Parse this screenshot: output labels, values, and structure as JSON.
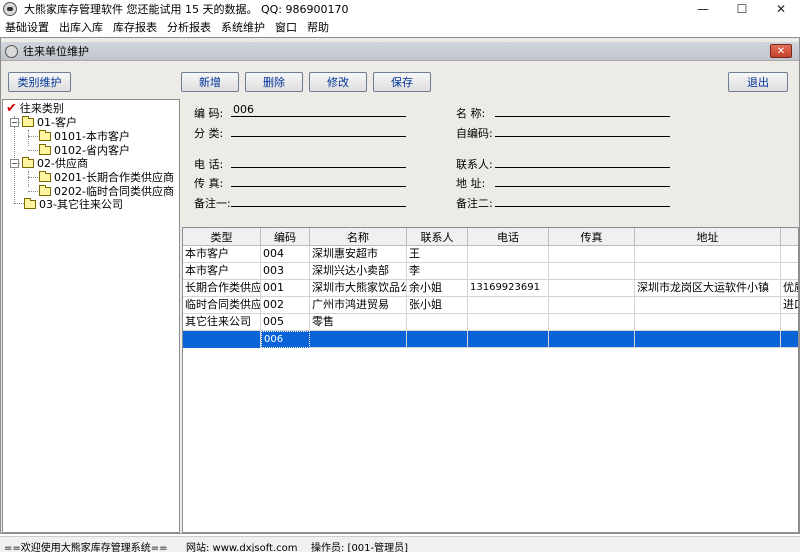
{
  "window": {
    "title": "大熊家库存管理软件  您还能试用 15 天的数据。    QQ:  986900170",
    "minimize": "—",
    "maximize": "☐",
    "close": "✕"
  },
  "menu": [
    "基础设置",
    "出库入库",
    "库存报表",
    "分析报表",
    "系统维护",
    "窗口",
    "帮助"
  ],
  "child": {
    "title": "往来单位维护",
    "close": "✕"
  },
  "toolbar": {
    "category_maint": "类别维护",
    "new": "新增",
    "delete": "删除",
    "edit": "修改",
    "save": "保存",
    "exit": "退出"
  },
  "tree": {
    "root": "往来类别",
    "nodes": [
      {
        "label": "01-客户",
        "children": [
          "0101-本市客户",
          "0102-省内客户"
        ]
      },
      {
        "label": "02-供应商",
        "children": [
          "0201-长期合作类供应商",
          "0202-临时合同类供应商"
        ]
      },
      {
        "label": "03-其它往来公司",
        "children": []
      }
    ]
  },
  "form": {
    "code_label": "编  码:",
    "code_value": "006",
    "name_label": "名  称:",
    "name_value": "",
    "category_label": "分  类:",
    "category_value": "",
    "auto_code_label": "自编码:",
    "auto_code_value": "",
    "phone_label": "电  话:",
    "phone_value": "",
    "contact_label": "联系人:",
    "contact_value": "",
    "fax_label": "传  真:",
    "fax_value": "",
    "address_label": "地  址:",
    "address_value": "",
    "note1_label": "备注一:",
    "note1_value": "",
    "note2_label": "备注二:",
    "note2_value": ""
  },
  "grid": {
    "columns": [
      "类型",
      "编码",
      "名称",
      "联系人",
      "电话",
      "传真",
      "地址",
      ""
    ],
    "rows": [
      [
        "本市客户",
        "004",
        "深圳惠安超市",
        "王",
        "",
        "",
        "",
        ""
      ],
      [
        "本市客户",
        "003",
        "深圳兴达小卖部",
        "李",
        "",
        "",
        "",
        ""
      ],
      [
        "长期合作类供应商",
        "001",
        "深圳市大熊家饮品公司",
        "余小姐",
        "13169923691",
        "",
        "深圳市龙岗区大运软件小镇",
        "优质"
      ],
      [
        "临时合同类供应商",
        "002",
        "广州市鸿进贸易",
        "张小姐",
        "",
        "",
        "",
        "进口"
      ],
      [
        "其它往来公司",
        "005",
        "零售",
        "",
        "",
        "",
        "",
        ""
      ],
      [
        "",
        "006",
        "",
        "",
        "",
        "",
        "",
        ""
      ]
    ],
    "selected_row": 5
  },
  "status": {
    "welcome": "==欢迎使用大熊家库存管理系统==",
    "website": "网站:  www.dxjsoft.com",
    "operator": "操作员:  [001-管理员]"
  },
  "icons": {
    "app": "bear-app-icon",
    "tree_root": "red-check-icon",
    "folder": "folder-icon"
  },
  "colors": {
    "selection": "#0a64d8",
    "button_text": "#003399",
    "close_button": "#c2412c"
  }
}
